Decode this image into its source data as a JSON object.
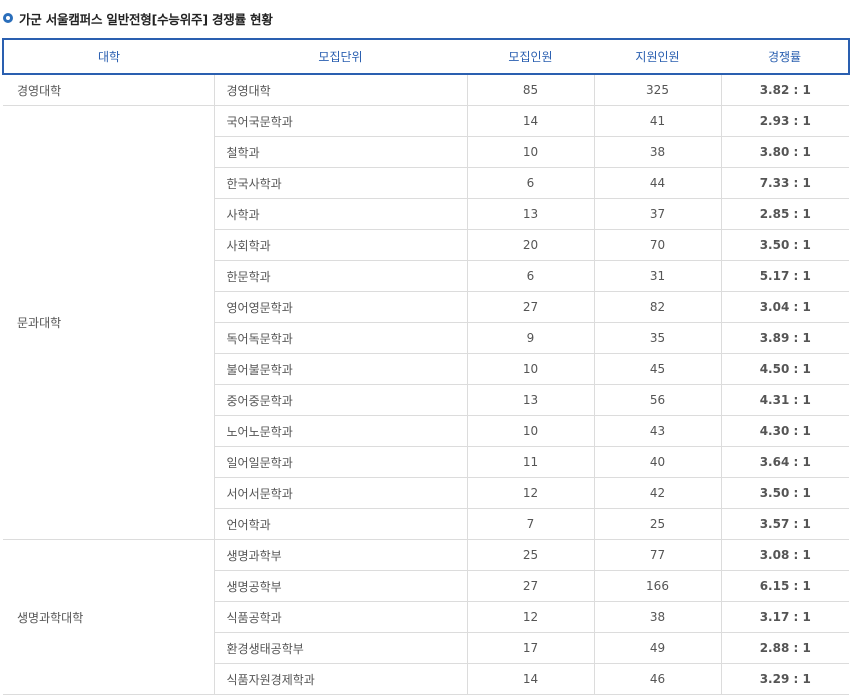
{
  "title": "가군 서울캠퍼스 일반전형[수능위주] 경쟁률 현황",
  "headers": [
    "대학",
    "모집단위",
    "모집인원",
    "지원인원",
    "경쟁률"
  ],
  "colors": {
    "accent": "#2a5fb0",
    "rate_blue": "#3b46c8",
    "rate_gray": "#444444",
    "rate_red": "#c8102e"
  },
  "groups": [
    {
      "college": "경영대학",
      "rows": [
        {
          "unit": "경영대학",
          "quota": "85",
          "applicants": "325",
          "rate": "3.82 : 1",
          "tone": "blue"
        }
      ]
    },
    {
      "college": "문과대학",
      "rows": [
        {
          "unit": "국어국문학과",
          "quota": "14",
          "applicants": "41",
          "rate": "2.93 : 1",
          "tone": "gray"
        },
        {
          "unit": "철학과",
          "quota": "10",
          "applicants": "38",
          "rate": "3.80 : 1",
          "tone": "blue"
        },
        {
          "unit": "한국사학과",
          "quota": "6",
          "applicants": "44",
          "rate": "7.33 : 1",
          "tone": "red"
        },
        {
          "unit": "사학과",
          "quota": "13",
          "applicants": "37",
          "rate": "2.85 : 1",
          "tone": "gray"
        },
        {
          "unit": "사회학과",
          "quota": "20",
          "applicants": "70",
          "rate": "3.50 : 1",
          "tone": "blue"
        },
        {
          "unit": "한문학과",
          "quota": "6",
          "applicants": "31",
          "rate": "5.17 : 1",
          "tone": "red"
        },
        {
          "unit": "영어영문학과",
          "quota": "27",
          "applicants": "82",
          "rate": "3.04 : 1",
          "tone": "blue"
        },
        {
          "unit": "독어독문학과",
          "quota": "9",
          "applicants": "35",
          "rate": "3.89 : 1",
          "tone": "blue"
        },
        {
          "unit": "불어불문학과",
          "quota": "10",
          "applicants": "45",
          "rate": "4.50 : 1",
          "tone": "blue"
        },
        {
          "unit": "중어중문학과",
          "quota": "13",
          "applicants": "56",
          "rate": "4.31 : 1",
          "tone": "blue"
        },
        {
          "unit": "노어노문학과",
          "quota": "10",
          "applicants": "43",
          "rate": "4.30 : 1",
          "tone": "blue"
        },
        {
          "unit": "일어일문학과",
          "quota": "11",
          "applicants": "40",
          "rate": "3.64 : 1",
          "tone": "blue"
        },
        {
          "unit": "서어서문학과",
          "quota": "12",
          "applicants": "42",
          "rate": "3.50 : 1",
          "tone": "blue"
        },
        {
          "unit": "언어학과",
          "quota": "7",
          "applicants": "25",
          "rate": "3.57 : 1",
          "tone": "blue"
        }
      ]
    },
    {
      "college": "생명과학대학",
      "rows": [
        {
          "unit": "생명과학부",
          "quota": "25",
          "applicants": "77",
          "rate": "3.08 : 1",
          "tone": "blue"
        },
        {
          "unit": "생명공학부",
          "quota": "27",
          "applicants": "166",
          "rate": "6.15 : 1",
          "tone": "red"
        },
        {
          "unit": "식품공학과",
          "quota": "12",
          "applicants": "38",
          "rate": "3.17 : 1",
          "tone": "blue"
        },
        {
          "unit": "환경생태공학부",
          "quota": "17",
          "applicants": "49",
          "rate": "2.88 : 1",
          "tone": "gray"
        },
        {
          "unit": "식품자원경제학과",
          "quota": "14",
          "applicants": "46",
          "rate": "3.29 : 1",
          "tone": "blue"
        }
      ]
    }
  ]
}
